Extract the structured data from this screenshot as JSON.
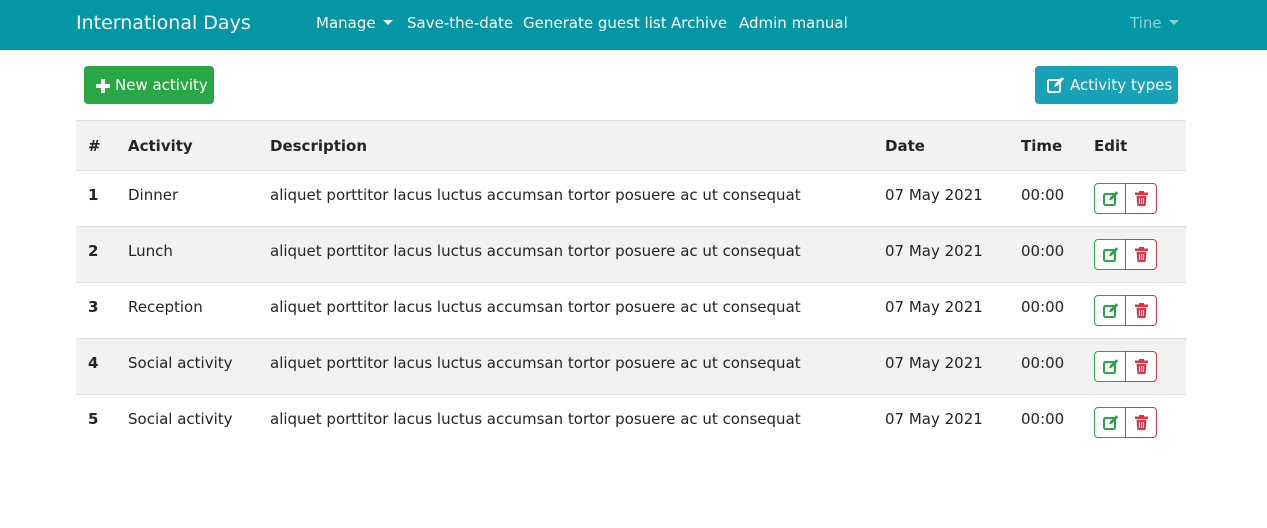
{
  "navbar": {
    "brand": "International Days",
    "manage": "Manage",
    "save_the_date": "Save-the-date",
    "guest_list": "Generate guest list",
    "archive": "Archive",
    "admin_manual": "Admin manual",
    "user": "Tine"
  },
  "toolbar": {
    "new_activity": "New activity",
    "activity_types": "Activity types"
  },
  "colors": {
    "navbar": "#0397a6",
    "success": "#28a745",
    "info": "#17a2b8",
    "danger": "#dc3545"
  },
  "table": {
    "headers": {
      "num": "#",
      "activity": "Activity",
      "description": "Description",
      "date": "Date",
      "time": "Time",
      "edit": "Edit"
    },
    "rows": [
      {
        "num": "1",
        "activity": "Dinner",
        "description": "aliquet porttitor lacus luctus accumsan tortor posuere ac ut consequat",
        "date": "07 May 2021",
        "time": "00:00"
      },
      {
        "num": "2",
        "activity": "Lunch",
        "description": "aliquet porttitor lacus luctus accumsan tortor posuere ac ut consequat",
        "date": "07 May 2021",
        "time": "00:00"
      },
      {
        "num": "3",
        "activity": "Reception",
        "description": "aliquet porttitor lacus luctus accumsan tortor posuere ac ut consequat",
        "date": "07 May 2021",
        "time": "00:00"
      },
      {
        "num": "4",
        "activity": "Social activity",
        "description": "aliquet porttitor lacus luctus accumsan tortor posuere ac ut consequat",
        "date": "07 May 2021",
        "time": "00:00"
      },
      {
        "num": "5",
        "activity": "Social activity",
        "description": "aliquet porttitor lacus luctus accumsan tortor posuere ac ut consequat",
        "date": "07 May 2021",
        "time": "00:00"
      }
    ]
  },
  "icons": {
    "add": "plus-icon",
    "types": "edit-icon",
    "row_edit": "edit-icon",
    "row_delete": "trash-icon"
  }
}
